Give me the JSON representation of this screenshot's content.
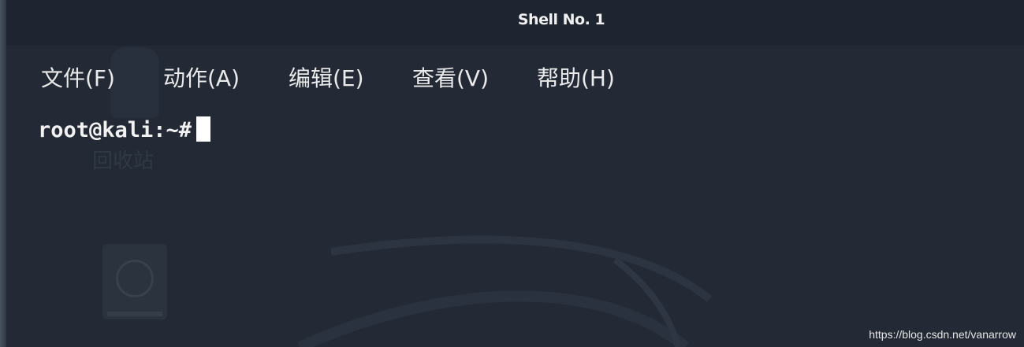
{
  "window": {
    "title": "Shell No. 1"
  },
  "menu": {
    "items": [
      {
        "label": "文件(F)"
      },
      {
        "label": "动作(A)"
      },
      {
        "label": "编辑(E)"
      },
      {
        "label": "查看(V)"
      },
      {
        "label": "帮助(H)"
      }
    ]
  },
  "terminal": {
    "prompt": "root@kali:~#"
  },
  "desktop": {
    "ghost_label": "回收站"
  },
  "watermark": "https://blog.csdn.net/vanarrow",
  "colors": {
    "background": "#232a35",
    "titlebar": "#1f2530",
    "text": "#f2f2f2"
  }
}
